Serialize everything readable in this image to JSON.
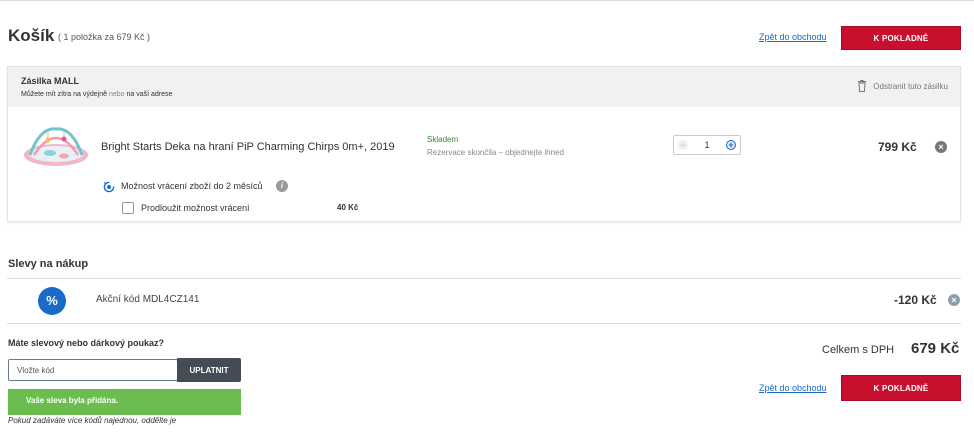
{
  "cart": {
    "title": "Košík",
    "subtitle": "( 1 položka za 679 Kč )",
    "back_link": "Zpět do obchodu",
    "checkout_label": "K POKLADNĚ"
  },
  "shipment": {
    "title": "Zásilka MALL",
    "sub_prefix": "Můžete mít zítra na výdejně",
    "sub_or": "nebo",
    "sub_suffix": "na vaší adrese",
    "remove_label": "Odstranit tuto zásilku"
  },
  "item": {
    "name": "Bright Starts Deka na hraní PiP Charming Chirps 0m+, 2019",
    "stock": "Skladem",
    "stock_note": "Rezervace skončila – objednejte ihned",
    "quantity": "1",
    "price": "799 Kč",
    "return_option": "Možnost vrácení zboží do 2 měsíců",
    "extend_label": "Prodloužit možnost vrácení",
    "extend_price": "40 Kč",
    "extend_checked": false
  },
  "discounts": {
    "title": "Slevy na nákup",
    "promo_icon": "%",
    "promo_label": "Akční kód MDL4CZ141",
    "promo_amount": "-120 Kč"
  },
  "voucher": {
    "question": "Máte slevový nebo dárkový poukaz?",
    "placeholder": "Vložte kód",
    "apply_label": "UPLATNIT",
    "success": "Vaše sleva byla přidána.",
    "note": "Pokud zadáváte více kódů najednou, oddělte je"
  },
  "summary": {
    "total_label": "Celkem s DPH",
    "total_value": "679 Kč",
    "back_link": "Zpět do obchodu",
    "checkout_label": "K POKLADNĚ"
  },
  "colors": {
    "accent_red": "#c8102e",
    "link_blue": "#1a6ac9",
    "stock_green": "#2a8a3a",
    "success_green": "#6cbd4f"
  }
}
